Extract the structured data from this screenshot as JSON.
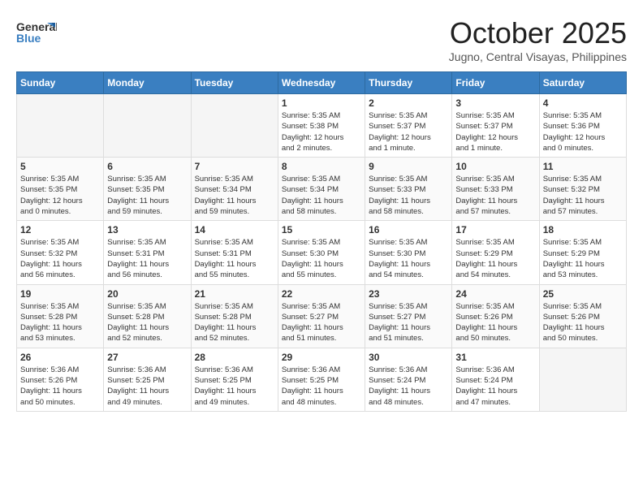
{
  "header": {
    "logo_line1": "General",
    "logo_line2": "Blue",
    "month": "October 2025",
    "location": "Jugno, Central Visayas, Philippines"
  },
  "weekdays": [
    "Sunday",
    "Monday",
    "Tuesday",
    "Wednesday",
    "Thursday",
    "Friday",
    "Saturday"
  ],
  "weeks": [
    [
      {
        "day": "",
        "info": ""
      },
      {
        "day": "",
        "info": ""
      },
      {
        "day": "",
        "info": ""
      },
      {
        "day": "1",
        "info": "Sunrise: 5:35 AM\nSunset: 5:38 PM\nDaylight: 12 hours\nand 2 minutes."
      },
      {
        "day": "2",
        "info": "Sunrise: 5:35 AM\nSunset: 5:37 PM\nDaylight: 12 hours\nand 1 minute."
      },
      {
        "day": "3",
        "info": "Sunrise: 5:35 AM\nSunset: 5:37 PM\nDaylight: 12 hours\nand 1 minute."
      },
      {
        "day": "4",
        "info": "Sunrise: 5:35 AM\nSunset: 5:36 PM\nDaylight: 12 hours\nand 0 minutes."
      }
    ],
    [
      {
        "day": "5",
        "info": "Sunrise: 5:35 AM\nSunset: 5:35 PM\nDaylight: 12 hours\nand 0 minutes."
      },
      {
        "day": "6",
        "info": "Sunrise: 5:35 AM\nSunset: 5:35 PM\nDaylight: 11 hours\nand 59 minutes."
      },
      {
        "day": "7",
        "info": "Sunrise: 5:35 AM\nSunset: 5:34 PM\nDaylight: 11 hours\nand 59 minutes."
      },
      {
        "day": "8",
        "info": "Sunrise: 5:35 AM\nSunset: 5:34 PM\nDaylight: 11 hours\nand 58 minutes."
      },
      {
        "day": "9",
        "info": "Sunrise: 5:35 AM\nSunset: 5:33 PM\nDaylight: 11 hours\nand 58 minutes."
      },
      {
        "day": "10",
        "info": "Sunrise: 5:35 AM\nSunset: 5:33 PM\nDaylight: 11 hours\nand 57 minutes."
      },
      {
        "day": "11",
        "info": "Sunrise: 5:35 AM\nSunset: 5:32 PM\nDaylight: 11 hours\nand 57 minutes."
      }
    ],
    [
      {
        "day": "12",
        "info": "Sunrise: 5:35 AM\nSunset: 5:32 PM\nDaylight: 11 hours\nand 56 minutes."
      },
      {
        "day": "13",
        "info": "Sunrise: 5:35 AM\nSunset: 5:31 PM\nDaylight: 11 hours\nand 56 minutes."
      },
      {
        "day": "14",
        "info": "Sunrise: 5:35 AM\nSunset: 5:31 PM\nDaylight: 11 hours\nand 55 minutes."
      },
      {
        "day": "15",
        "info": "Sunrise: 5:35 AM\nSunset: 5:30 PM\nDaylight: 11 hours\nand 55 minutes."
      },
      {
        "day": "16",
        "info": "Sunrise: 5:35 AM\nSunset: 5:30 PM\nDaylight: 11 hours\nand 54 minutes."
      },
      {
        "day": "17",
        "info": "Sunrise: 5:35 AM\nSunset: 5:29 PM\nDaylight: 11 hours\nand 54 minutes."
      },
      {
        "day": "18",
        "info": "Sunrise: 5:35 AM\nSunset: 5:29 PM\nDaylight: 11 hours\nand 53 minutes."
      }
    ],
    [
      {
        "day": "19",
        "info": "Sunrise: 5:35 AM\nSunset: 5:28 PM\nDaylight: 11 hours\nand 53 minutes."
      },
      {
        "day": "20",
        "info": "Sunrise: 5:35 AM\nSunset: 5:28 PM\nDaylight: 11 hours\nand 52 minutes."
      },
      {
        "day": "21",
        "info": "Sunrise: 5:35 AM\nSunset: 5:28 PM\nDaylight: 11 hours\nand 52 minutes."
      },
      {
        "day": "22",
        "info": "Sunrise: 5:35 AM\nSunset: 5:27 PM\nDaylight: 11 hours\nand 51 minutes."
      },
      {
        "day": "23",
        "info": "Sunrise: 5:35 AM\nSunset: 5:27 PM\nDaylight: 11 hours\nand 51 minutes."
      },
      {
        "day": "24",
        "info": "Sunrise: 5:35 AM\nSunset: 5:26 PM\nDaylight: 11 hours\nand 50 minutes."
      },
      {
        "day": "25",
        "info": "Sunrise: 5:35 AM\nSunset: 5:26 PM\nDaylight: 11 hours\nand 50 minutes."
      }
    ],
    [
      {
        "day": "26",
        "info": "Sunrise: 5:36 AM\nSunset: 5:26 PM\nDaylight: 11 hours\nand 50 minutes."
      },
      {
        "day": "27",
        "info": "Sunrise: 5:36 AM\nSunset: 5:25 PM\nDaylight: 11 hours\nand 49 minutes."
      },
      {
        "day": "28",
        "info": "Sunrise: 5:36 AM\nSunset: 5:25 PM\nDaylight: 11 hours\nand 49 minutes."
      },
      {
        "day": "29",
        "info": "Sunrise: 5:36 AM\nSunset: 5:25 PM\nDaylight: 11 hours\nand 48 minutes."
      },
      {
        "day": "30",
        "info": "Sunrise: 5:36 AM\nSunset: 5:24 PM\nDaylight: 11 hours\nand 48 minutes."
      },
      {
        "day": "31",
        "info": "Sunrise: 5:36 AM\nSunset: 5:24 PM\nDaylight: 11 hours\nand 47 minutes."
      },
      {
        "day": "",
        "info": ""
      }
    ]
  ]
}
